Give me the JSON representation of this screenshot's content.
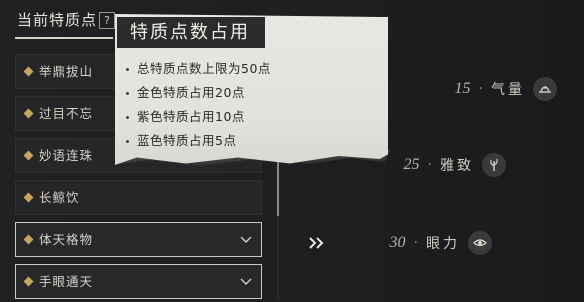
{
  "header": {
    "title": "当前特质点",
    "help_label": "?"
  },
  "traits": [
    {
      "label": "举鼎拔山",
      "selected": false,
      "expandable": false
    },
    {
      "label": "过目不忘",
      "selected": false,
      "expandable": false
    },
    {
      "label": "妙语连珠",
      "selected": false,
      "expandable": false
    },
    {
      "label": "长鲸饮",
      "selected": false,
      "expandable": false
    },
    {
      "label": "体天格物",
      "selected": true,
      "expandable": true
    },
    {
      "label": "手眼通天",
      "selected": true,
      "expandable": true
    }
  ],
  "tooltip": {
    "title": "特质点数占用",
    "bullets": [
      "总特质点数上限为50点",
      "金色特质占用20点",
      "紫色特质占用10点",
      "蓝色特质占用5点"
    ]
  },
  "transfer_icon": "double-chevron-right-icon",
  "attributes": [
    {
      "value": "15",
      "separator": "·",
      "name": "气量",
      "icon": "hat-icon"
    },
    {
      "value": "25",
      "separator": "·",
      "name": "雅致",
      "icon": "feather-icon"
    },
    {
      "value": "30",
      "separator": "·",
      "name": "眼力",
      "icon": "eye-icon"
    }
  ],
  "colors": {
    "background": "#1e1e20",
    "trait_diamond": "#c9a45e",
    "tooltip_paper": "#e5e3de",
    "tooltip_title_bg": "#2c2c2d",
    "selected_border": "#cfc9bd",
    "text_light": "#d6d1c7"
  }
}
